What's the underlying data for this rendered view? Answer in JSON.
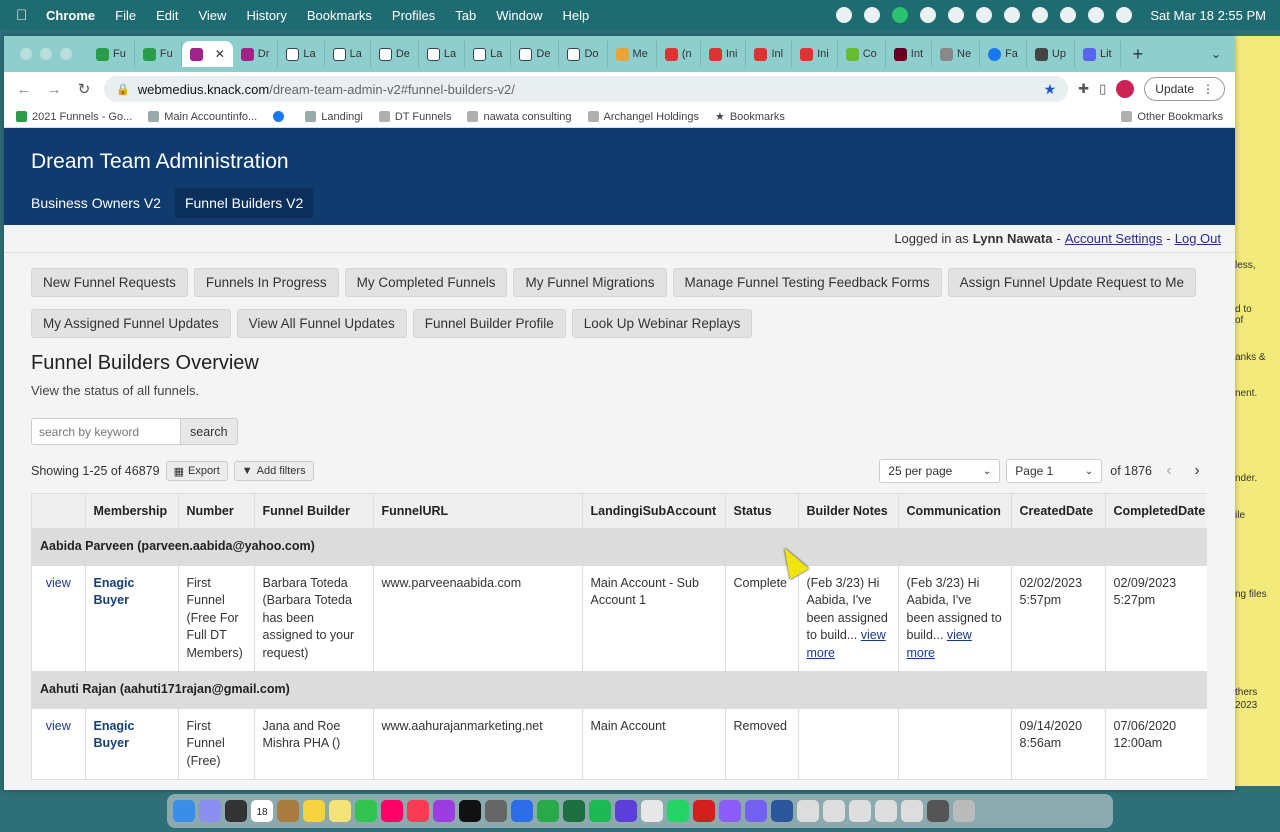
{
  "menubar": {
    "app": "Chrome",
    "items": [
      "File",
      "Edit",
      "View",
      "History",
      "Bookmarks",
      "Profiles",
      "Tab",
      "Window",
      "Help"
    ],
    "clock": "Sat Mar 18  2:55 PM"
  },
  "browser": {
    "tabs": [
      "Fu",
      "Fu",
      "",
      "Dr",
      "La",
      "La",
      "De",
      "La",
      "La",
      "De",
      "Do",
      "Me",
      "(n",
      "Ini",
      "Inl",
      "Ini",
      "Co",
      "Int",
      "Ne",
      "Fa",
      "Up",
      "Lit"
    ],
    "url_host": "webmedius.knack.com",
    "url_path": "/dream-team-admin-v2#funnel-builders-v2/",
    "update_label": "Update",
    "bookmarks": [
      "2021 Funnels - Go...",
      "Main Accountinfo...",
      "",
      "Landingi",
      "DT Funnels",
      "nawata consulting",
      "Archangel Holdings",
      "Bookmarks"
    ],
    "other_bookmarks": "Other Bookmarks"
  },
  "app": {
    "title": "Dream Team Administration",
    "nav": [
      "Business Owners V2",
      "Funnel Builders V2"
    ],
    "login": {
      "prefix": "Logged in as",
      "user": "Lynn Nawata",
      "sep": "-",
      "account_settings": "Account Settings",
      "logout": "Log Out"
    },
    "buttons_row1": [
      "New Funnel Requests",
      "Funnels In Progress",
      "My Completed Funnels",
      "My Funnel Migrations",
      "Manage Funnel Testing Feedback Forms",
      "Assign Funnel Update Request to Me"
    ],
    "buttons_row2": [
      "My Assigned Funnel Updates",
      "View All Funnel Updates",
      "Funnel Builder Profile",
      "Look Up Webinar Replays"
    ],
    "overview_title": "Funnel Builders Overview",
    "overview_sub": "View the status of all funnels.",
    "search": {
      "placeholder": "search by keyword",
      "button": "search"
    },
    "showing": "Showing 1-25 of 46879",
    "export_label": "Export",
    "filters_label": "Add filters",
    "per_page": "25 per page",
    "page": "Page 1",
    "of_pages": "of 1876",
    "table": {
      "headers": [
        "",
        "Membership",
        "Number",
        "Funnel Builder",
        "FunnelURL",
        "LandingiSubAccount",
        "Status",
        "Builder Notes",
        "Communication",
        "CreatedDate",
        "CompletedDate"
      ],
      "groups": [
        {
          "title": "Aabida Parveen (parveen.aabida@yahoo.com)",
          "row": {
            "view": "view",
            "membership": "Enagic Buyer",
            "number": "First Funnel (Free For Full DT Members)",
            "builder": "Barbara Toteda (Barbara Toteda has been assigned to your request)",
            "url": "www.parveenaabida.com",
            "subaccount": "Main Account - Sub Account 1",
            "status": "Complete",
            "notes": "(Feb 3/23) Hi Aabida, I've been assigned to build...",
            "notes_more": "view more",
            "communication": "(Feb 3/23) Hi Aabida, I've been assigned to build...",
            "comm_more": "view more",
            "created": "02/02/2023 5:57pm",
            "completed": "02/09/2023 5:27pm"
          }
        },
        {
          "title": "Aahuti Rajan (aahuti171rajan@gmail.com)",
          "row": {
            "view": "view",
            "membership": "Enagic Buyer",
            "number": "First Funnel (Free)",
            "builder": "Jana and Roe Mishra PHA ()",
            "url": "www.aahurajanmarketing.net",
            "subaccount": "Main Account",
            "status": "Removed",
            "notes": "",
            "notes_more": "",
            "communication": "",
            "comm_more": "",
            "created": "09/14/2020 8:56am",
            "completed": "07/06/2020 12:00am"
          }
        }
      ]
    }
  },
  "desktop_notes": [
    "less,",
    "d to",
    "of",
    "anks &",
    "nent.",
    "nder.",
    "ile",
    "ng files",
    "thers",
    "2023"
  ],
  "dock_date": "18"
}
